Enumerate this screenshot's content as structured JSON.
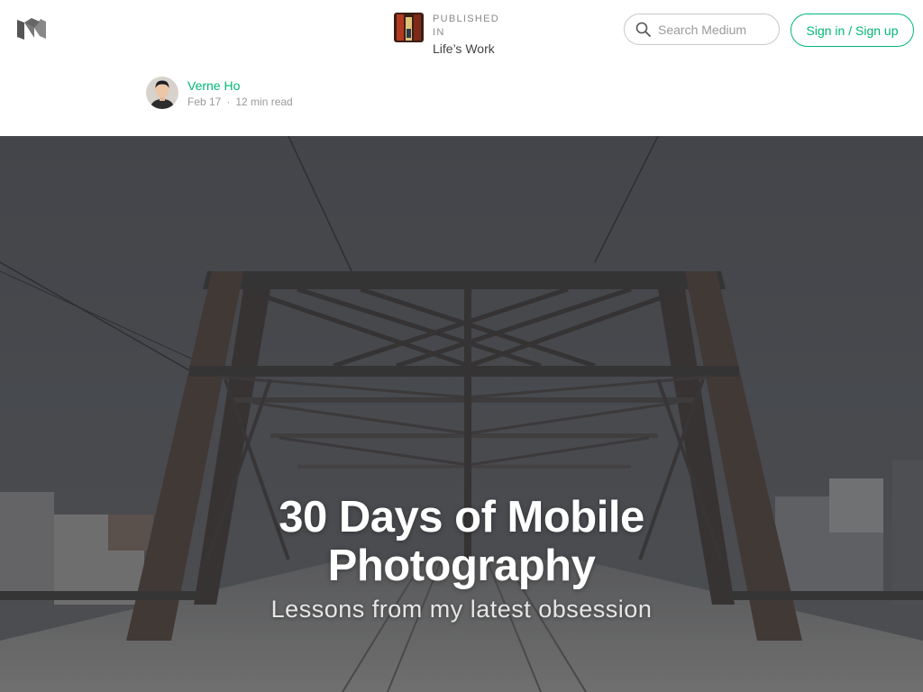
{
  "header": {
    "logo_icon": "medium-logo-icon",
    "publication": {
      "prefix": "PUBLISHED IN",
      "name": "Life’s Work"
    },
    "search": {
      "placeholder": "Search Medium",
      "value": ""
    },
    "signin_label": "Sign in / Sign up"
  },
  "author": {
    "name": "Verne Ho",
    "date": "Feb 17",
    "read_time": "12 min read"
  },
  "hero": {
    "title_lines": [
      "30 Days of Mobile",
      "Photography"
    ],
    "subtitle": "Lessons from my latest obsession"
  },
  "colors": {
    "accent": "#02b875",
    "muted_text": "#9a9a9a",
    "hero_overlay": "#3c3f44"
  }
}
